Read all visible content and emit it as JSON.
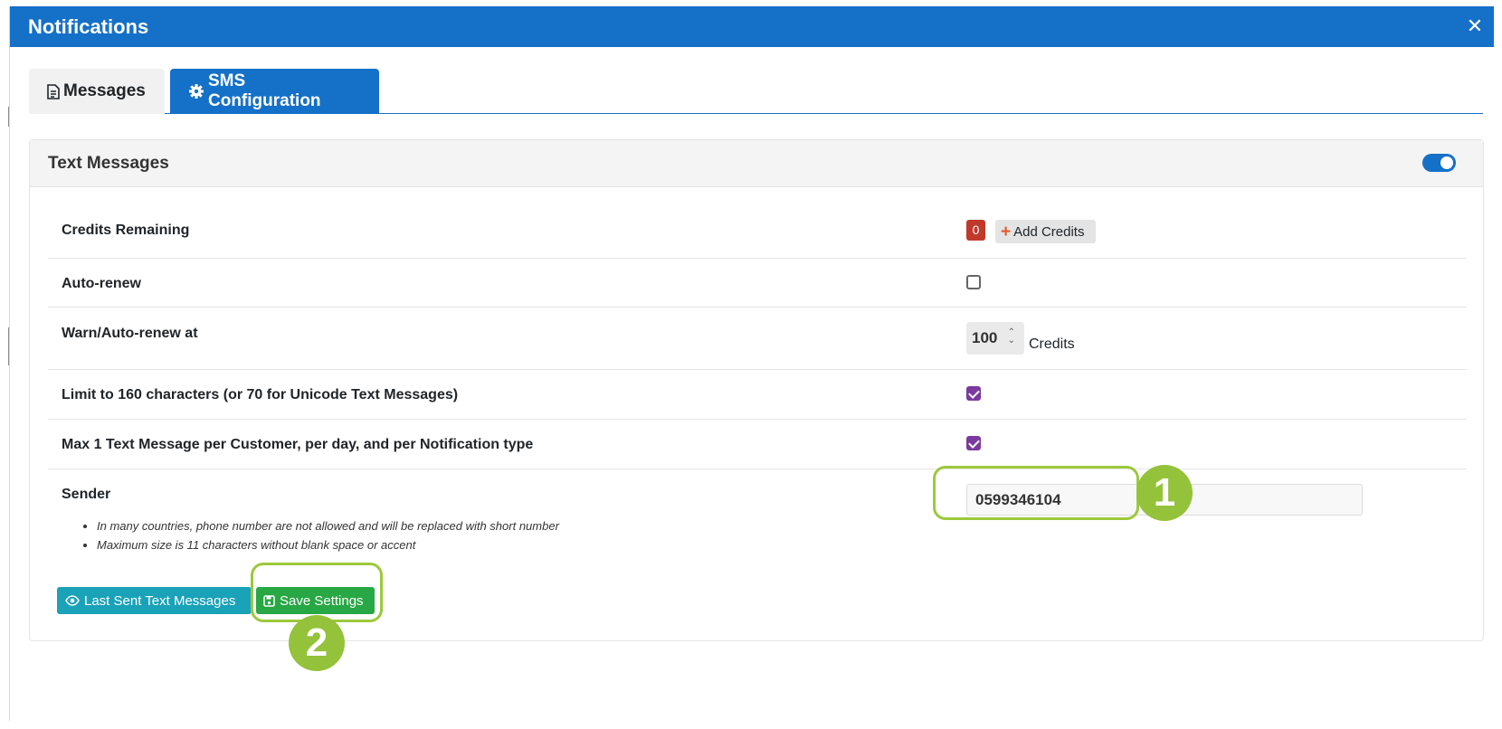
{
  "modal": {
    "title": "Notifications",
    "close_icon": "times-icon"
  },
  "tabs": [
    {
      "label": "Messages",
      "icon": "file-text-icon",
      "active": false
    },
    {
      "label": "SMS Configuration",
      "icon": "gear-icon",
      "active": true
    }
  ],
  "card": {
    "title": "Text Messages",
    "enabled": true,
    "rows": {
      "credits": {
        "label": "Credits Remaining",
        "value": "0",
        "add_button": "Add Credits"
      },
      "auto_renew": {
        "label": "Auto-renew",
        "checked": false
      },
      "warn": {
        "label": "Warn/Auto-renew at",
        "value": "100",
        "unit": "Credits"
      },
      "limit160": {
        "label": "Limit to 160 characters (or 70 for Unicode Text Messages)",
        "checked": true
      },
      "max1": {
        "label": "Max 1 Text Message per Customer, per day, and per Notification type",
        "checked": true
      },
      "sender": {
        "label": "Sender",
        "value": "0599346104",
        "notes": [
          "In many countries, phone number are not allowed and will be replaced with short number",
          "Maximum size is 11 characters without blank space or accent"
        ]
      }
    },
    "buttons": {
      "last_sent": "Last Sent Text Messages",
      "save": "Save Settings"
    }
  },
  "callouts": [
    "1",
    "2"
  ],
  "colors": {
    "primary": "#1570c8",
    "success": "#28a745",
    "info": "#19a2b8",
    "danger": "#c0392b",
    "callout": "#94c23a",
    "checkbox": "#7a3a9e"
  }
}
